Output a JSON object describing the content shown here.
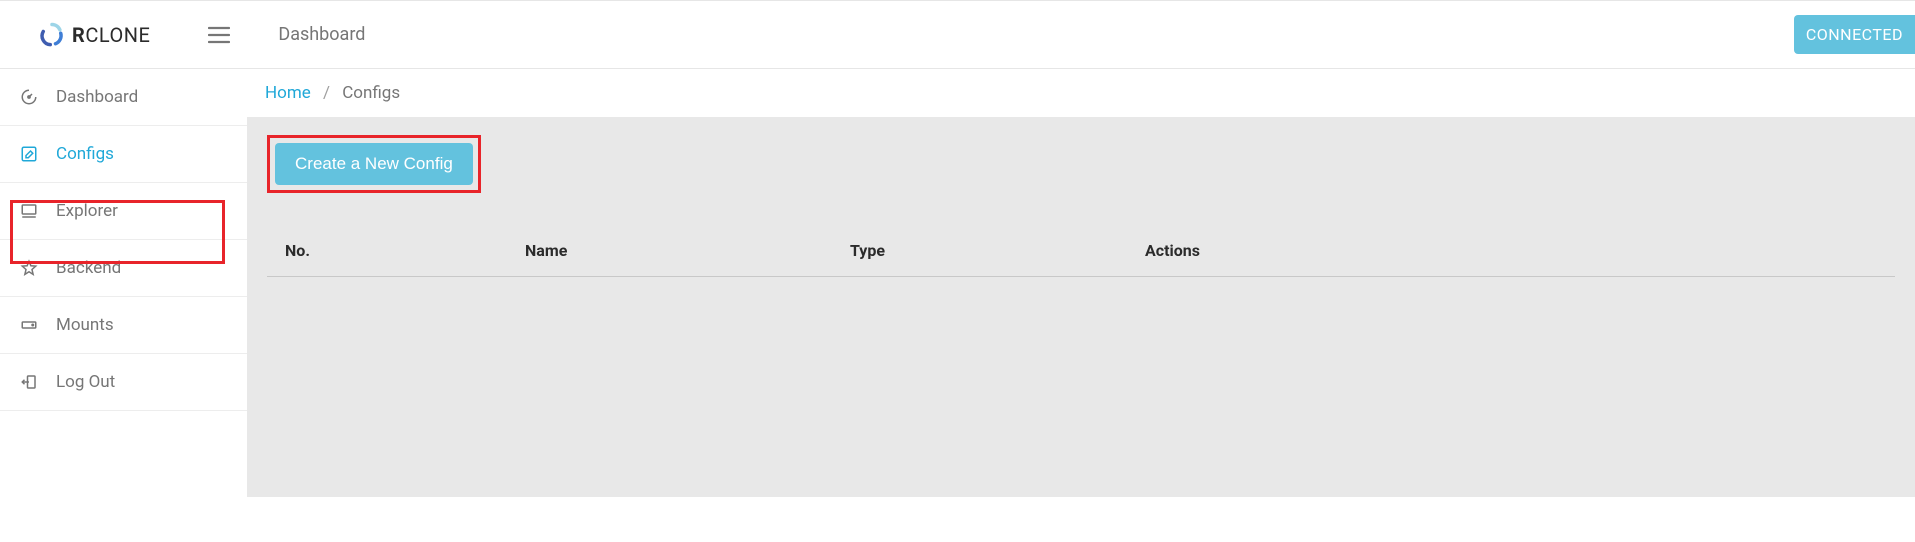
{
  "header": {
    "logo_text_bold": "R",
    "logo_text_rest": "CLONE",
    "title": "Dashboard",
    "status": "CONNECTED"
  },
  "sidebar": {
    "items": [
      {
        "label": "Dashboard",
        "icon": "gauge-icon",
        "active": false
      },
      {
        "label": "Configs",
        "icon": "edit-icon",
        "active": true
      },
      {
        "label": "Explorer",
        "icon": "monitor-icon",
        "active": false
      },
      {
        "label": "Backend",
        "icon": "star-icon",
        "active": false
      },
      {
        "label": "Mounts",
        "icon": "drive-icon",
        "active": false
      },
      {
        "label": "Log Out",
        "icon": "logout-icon",
        "active": false
      }
    ]
  },
  "breadcrumb": {
    "home": "Home",
    "current": "Configs"
  },
  "main": {
    "create_button": "Create a New Config",
    "table": {
      "columns": {
        "no": "No.",
        "name": "Name",
        "type": "Type",
        "actions": "Actions"
      },
      "rows": []
    }
  },
  "colors": {
    "accent": "#20a8d8",
    "badge": "#63c2de",
    "highlight": "#e8242a",
    "muted": "#767676",
    "content_bg": "#e8e8e8"
  }
}
